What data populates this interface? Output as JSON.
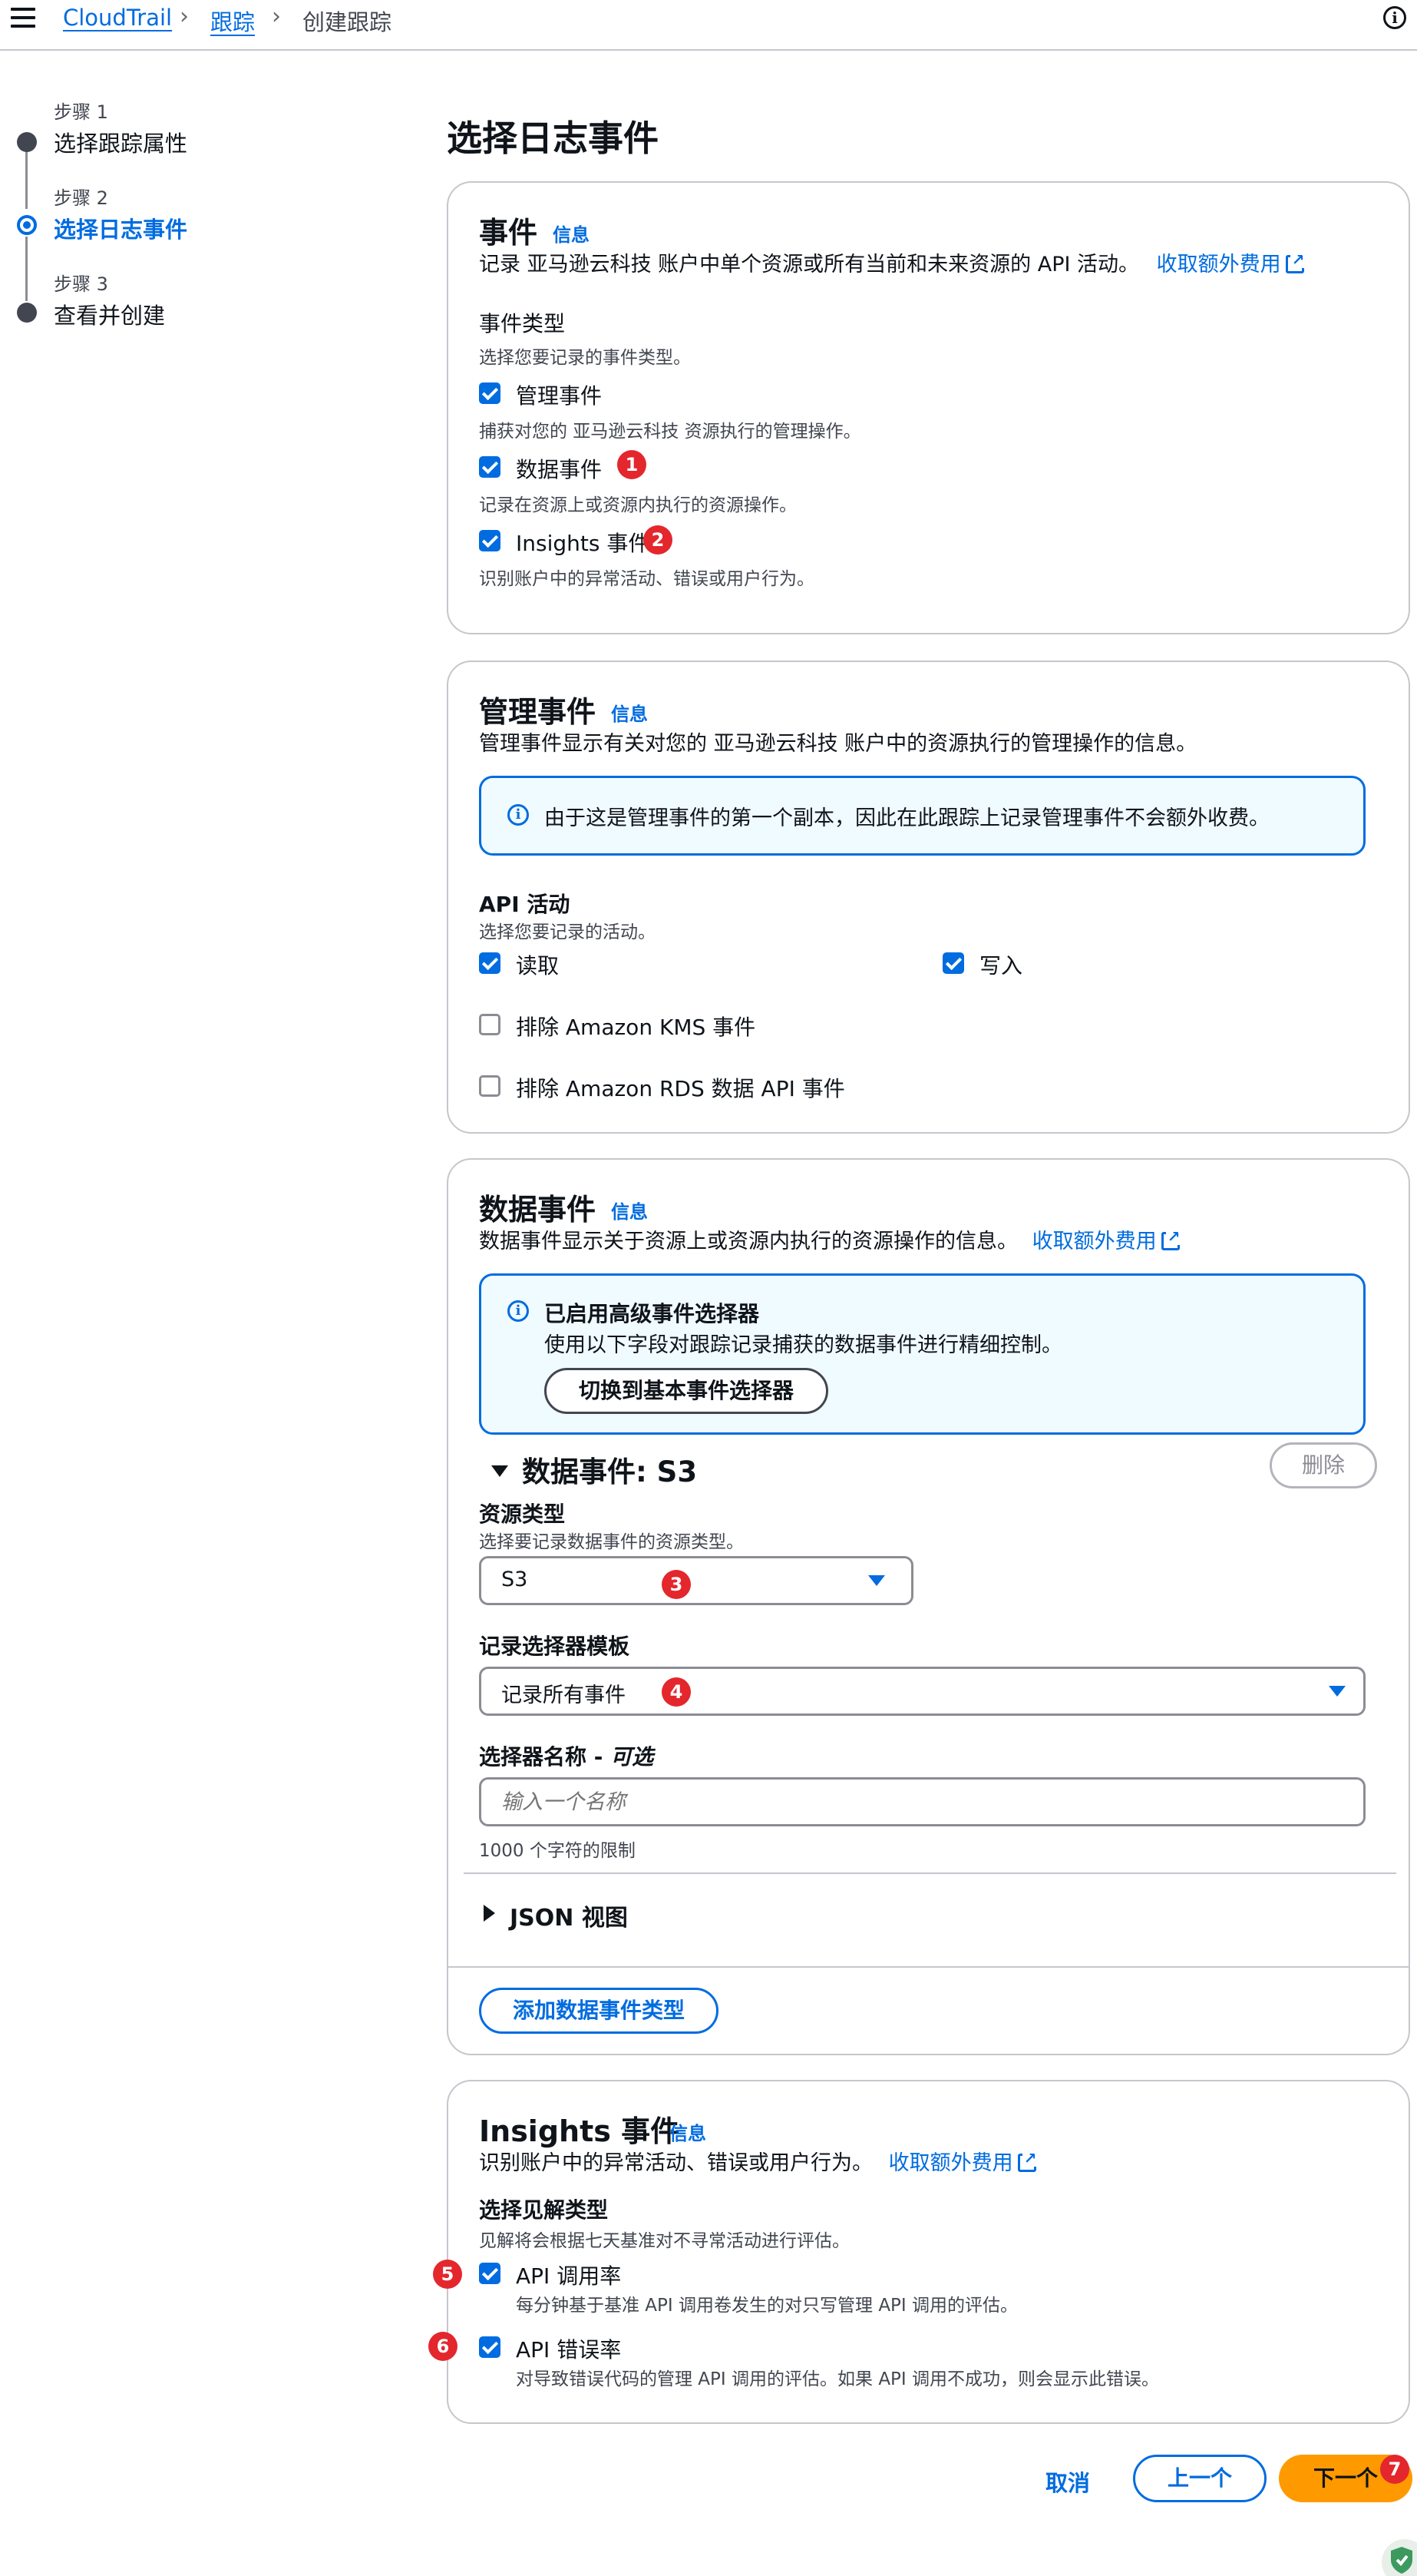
{
  "breadcrumb": {
    "root": "CloudTrail",
    "trails": "跟踪",
    "current": "创建跟踪"
  },
  "steps": [
    {
      "small": "步骤 1",
      "label": "选择跟踪属性",
      "active": false
    },
    {
      "small": "步骤 2",
      "label": "选择日志事件",
      "active": true
    },
    {
      "small": "步骤 3",
      "label": "查看并创建",
      "active": false
    }
  ],
  "page_title": "选择日志事件",
  "events_panel": {
    "title": "事件",
    "info": "信息",
    "description": "记录 亚马逊云科技 账户中单个资源或所有当前和未来资源的 API 活动。",
    "cost_link": "收取额外费用",
    "type_label": "事件类型",
    "type_hint": "选择您要记录的事件类型。",
    "options": [
      {
        "label": "管理事件",
        "hint": "捕获对您的 亚马逊云科技 资源执行的管理操作。",
        "checked": true
      },
      {
        "label": "数据事件",
        "hint": "记录在资源上或资源内执行的资源操作。",
        "checked": true
      },
      {
        "label": "Insights 事件",
        "hint": "识别账户中的异常活动、错误或用户行为。",
        "checked": true
      }
    ]
  },
  "management_panel": {
    "title": "管理事件",
    "info": "信息",
    "description": "管理事件显示有关对您的 亚马逊云科技 账户中的资源执行的管理操作的信息。",
    "alert": "由于这是管理事件的第一个副本，因此在此跟踪上记录管理事件不会额外收费。",
    "api_label": "API 活动",
    "api_hint": "选择您要记录的活动。",
    "read": "读取",
    "write": "写入",
    "exclude_kms": "排除 Amazon KMS 事件",
    "exclude_rds": "排除 Amazon RDS 数据 API 事件"
  },
  "data_panel": {
    "title": "数据事件",
    "info": "信息",
    "description": "数据事件显示关于资源上或资源内执行的资源操作的信息。",
    "cost_link": "收取额外费用",
    "alert_title": "已启用高级事件选择器",
    "alert_body": "使用以下字段对跟踪记录捕获的数据事件进行精细控制。",
    "switch_button": "切换到基本事件选择器",
    "section_title": "数据事件: S3",
    "delete_button": "删除",
    "resource_label": "资源类型",
    "resource_hint": "选择要记录数据事件的资源类型。",
    "resource_value": "S3",
    "template_label": "记录选择器模板",
    "template_value": "记录所有事件",
    "name_label": "选择器名称 - ",
    "name_optional": "可选",
    "name_placeholder": "输入一个名称",
    "name_limit": "1000 个字符的限制",
    "json_view": "JSON 视图",
    "add_button": "添加数据事件类型"
  },
  "insights_panel": {
    "title": "Insights 事件",
    "info": "信息",
    "description": "识别账户中的异常活动、错误或用户行为。",
    "cost_link": "收取额外费用",
    "type_label": "选择见解类型",
    "type_hint": "见解将会根据七天基准对不寻常活动进行评估。",
    "options": [
      {
        "label": "API 调用率",
        "hint": "每分钟基于基准 API 调用卷发生的对只写管理 API 调用的评估。",
        "checked": true
      },
      {
        "label": "API 错误率",
        "hint": "对导致错误代码的管理 API 调用的评估。如果 API 调用不成功，则会显示此错误。",
        "checked": true
      }
    ]
  },
  "footer": {
    "cancel": "取消",
    "previous": "上一个",
    "next": "下一个"
  },
  "markers": [
    "1",
    "2",
    "3",
    "4",
    "5",
    "6",
    "7"
  ],
  "colors": {
    "link": "#006ce0",
    "primary": "#ff9900",
    "marker": "#e4262d",
    "alert_bg": "#f0fbff"
  }
}
